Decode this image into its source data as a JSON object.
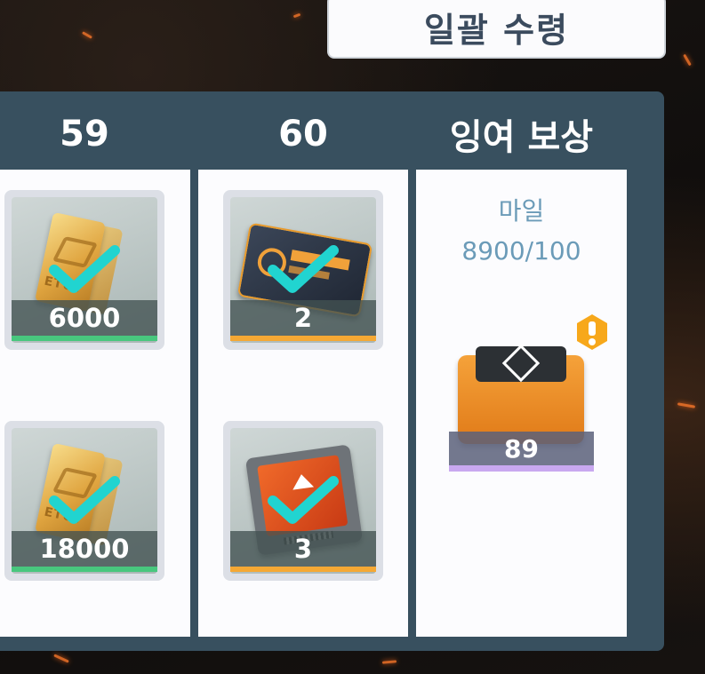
{
  "claim_all_label": "일괄 수령",
  "columns": [
    {
      "header": "59",
      "items": [
        {
          "icon": "gold-bar-icon",
          "qty": "6000",
          "accent": "#48c77e",
          "claimed": true
        },
        {
          "icon": "gold-bar-icon",
          "qty": "18000",
          "accent": "#48c77e",
          "claimed": true
        }
      ]
    },
    {
      "header": "60",
      "items": [
        {
          "icon": "access-card-icon",
          "qty": "2",
          "accent": "#f5a834",
          "claimed": true
        },
        {
          "icon": "upgrade-chip-icon",
          "qty": "3",
          "accent": "#f5a834",
          "claimed": true
        }
      ]
    }
  ],
  "surplus": {
    "header": "잉여 보상",
    "currency_label": "마일",
    "progress_text": "8900/100",
    "reward": {
      "icon": "supply-crate-icon",
      "qty": "89",
      "accent": "#c9a8f0"
    },
    "alert_icon": "exclamation-alert-icon"
  },
  "colors": {
    "panel": "#38505f",
    "check": "#21d4d0",
    "claim_text": "#3b4b5e",
    "alert": "#f7a81b"
  }
}
